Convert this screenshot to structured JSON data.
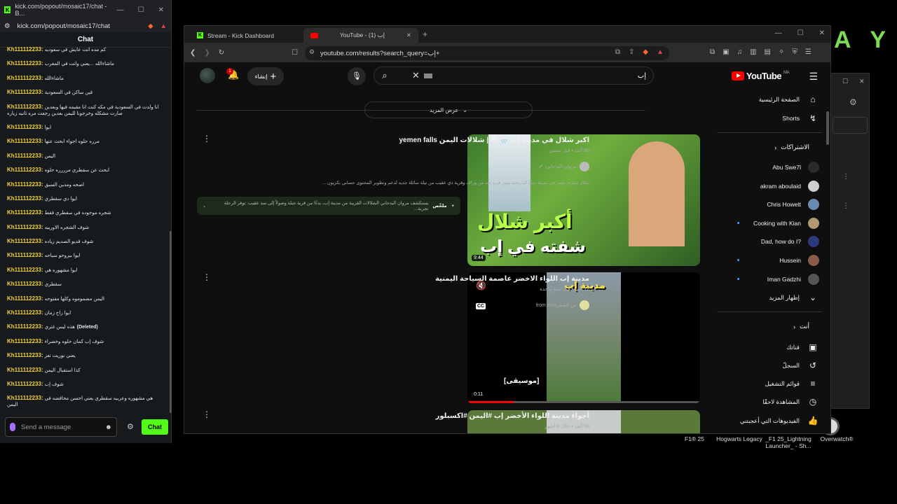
{
  "desktop": {
    "brand_text": "AY",
    "icons": [
      {
        "label": "F1® 25"
      },
      {
        "label": "Hogwarts Legacy"
      },
      {
        "label": "_F1 25_Lightning Launcher_ - Sh..."
      },
      {
        "label": "Overwatch®"
      }
    ]
  },
  "kick_window": {
    "title": "kick.com/popout/mosaic17/chat - B...",
    "url": "kick.com/popout/mosaic17/chat",
    "chat_header": "Chat",
    "messages": [
      {
        "user": "Kh111112233:",
        "text": "كم مده انت عايش في سعوديه"
      },
      {
        "user": "Kh111112233:",
        "text": "ماشاءالله ...يعني وانت في المغرب"
      },
      {
        "user": "Kh111112233:",
        "text": "ماشاءالله"
      },
      {
        "user": "Kh111112233:",
        "text": "فين ساكن في السعودية"
      },
      {
        "user": "Kh111112233:",
        "text": "انا ولدت في السعودية في مكه كنت انا مقيمه فيها وبعدين صارت مشكله وخرجونا لليمن بعدين رجعت مره ثانيه زياره"
      },
      {
        "user": "Kh111112233:",
        "text": "ايوا"
      },
      {
        "user": "Kh111112233:",
        "text": "مرره حلوه اجواء ابحث عنها"
      },
      {
        "user": "Kh111112233:",
        "text": "اليمن"
      },
      {
        "user": "Kh111112233:",
        "text": "ابحث عن سقطري مرررره حلوه"
      },
      {
        "user": "Kh111112233:",
        "text": "اصحه ومدين السبق"
      },
      {
        "user": "Kh111112233:",
        "text": "ايوا دي سقطري"
      },
      {
        "user": "Kh111112233:",
        "text": "شجره موجوده في سقطري فقط"
      },
      {
        "user": "Kh111112233:",
        "text": "شوف الشجره الاوربيه"
      },
      {
        "user": "Kh111112233:",
        "text": "شوف قديو الصديم زياده"
      },
      {
        "user": "Kh111112233:",
        "text": "ايوا بيروحو سياحه"
      },
      {
        "user": "Kh111112233:",
        "text": "ايوا مشهوره هي"
      },
      {
        "user": "Kh111112233:",
        "text": "سقطري"
      },
      {
        "user": "Kh111112233:",
        "text": "اليمن مضموموه وكلها مفتوحه"
      },
      {
        "user": "Kh111112233:",
        "text": "ايوا راح زمان"
      },
      {
        "user": "Kh111112233:",
        "text": "هذه ليس غتري",
        "deleted": "(Deleted)"
      },
      {
        "user": "Kh111112233:",
        "text": "شوف إب كمان حلوه وخضراء"
      },
      {
        "user": "Kh111112233:",
        "text": "يعني نوريت تعز"
      },
      {
        "user": "Kh111112233:",
        "text": "كذا استقبال اليمن"
      },
      {
        "user": "Kh111112233:",
        "text": "شوف إب"
      },
      {
        "user": "Kh111112233:",
        "text": "هي مشهوره وعربيه سقطري يعني احسن محافضه في اليمن"
      }
    ],
    "composer_placeholder": "Send a message",
    "chat_button": "Chat"
  },
  "browser": {
    "tabs": [
      {
        "label": "Stream - Kick Dashboard"
      },
      {
        "label": "YouTube - إب (1)"
      }
    ],
    "url": "youtube.com/results?search_query=إب+"
  },
  "youtube": {
    "logo_text": "YouTube",
    "logo_region": "MA",
    "search_query": "إب",
    "create_label": "إنشاء",
    "notif_count": "1",
    "show_more": "عرض المزيد",
    "sidebar": {
      "home": "الصفحة الرئيسية",
      "shorts": "Shorts",
      "subscriptions_header": "الاشتراكات",
      "subscriptions": [
        {
          "name": "Abu Swe7l",
          "color": "#2a2a2a"
        },
        {
          "name": "akram aboulaid",
          "color": "#cfcfcf"
        },
        {
          "name": "Chris Howett",
          "color": "#6a8ab0"
        },
        {
          "name": "Cooking with Kian",
          "color": "#b09a70"
        },
        {
          "name": "Dad, how do I?",
          "color": "#2a3a7a"
        },
        {
          "name": "Hussein",
          "color": "#8a5a4a"
        },
        {
          "name": "Iman Gadzhi",
          "color": "#555555"
        }
      ],
      "show_more": "إظهار المزيد",
      "you_header": "أنت",
      "you_items": [
        "قناتك",
        "السجلّ",
        "قوائم التشغيل",
        "المشاهدة لاحقًا",
        "الفيديوهات التي أعجبتني"
      ]
    },
    "results": [
      {
        "title": "اكبر شلال في مدينة إب 🌧️ 😳 | شلالات اليمن yemen falls",
        "meta": "88 ألف • قبل سنتين",
        "channel": "مروان البدحاني",
        "desc": "شلال بحاره، عصر في مدينة جبلة التاريخية وبين قرية تعد من وراف وقرية ذي عقيب من تيلة سائلة جديد لدعم وتطوير المحتوى حسابي بكريون ...",
        "summary_label": "ملخّص",
        "summary": "يستكشف مروان البدحاني الشلالات القريبة من مدينة إب، بدءًا من قرية جبلة وصولاً إلى سد عقيب. توفر الرحلة تجربة...",
        "duration": "9:44",
        "thumb_line1": "أكبر شلال",
        "thumb_line2": "شفته في إب"
      },
      {
        "title": "مدينة إب اللواء الاخضر عاصمة السياحة اليمنية",
        "meta": "12 ألف • قبل سنة واحدة",
        "channel": "من الصفرfrom zero",
        "duration": "0:11",
        "overlay": "مدينة إب",
        "caption": "[موسيقى]",
        "progress": 0.2
      },
      {
        "title": "أجواء مدينة اللواء الأخضر إب #اليمن #اكسبلور",
        "meta": "68 ألف • خلال 8 أشهر"
      }
    ]
  }
}
